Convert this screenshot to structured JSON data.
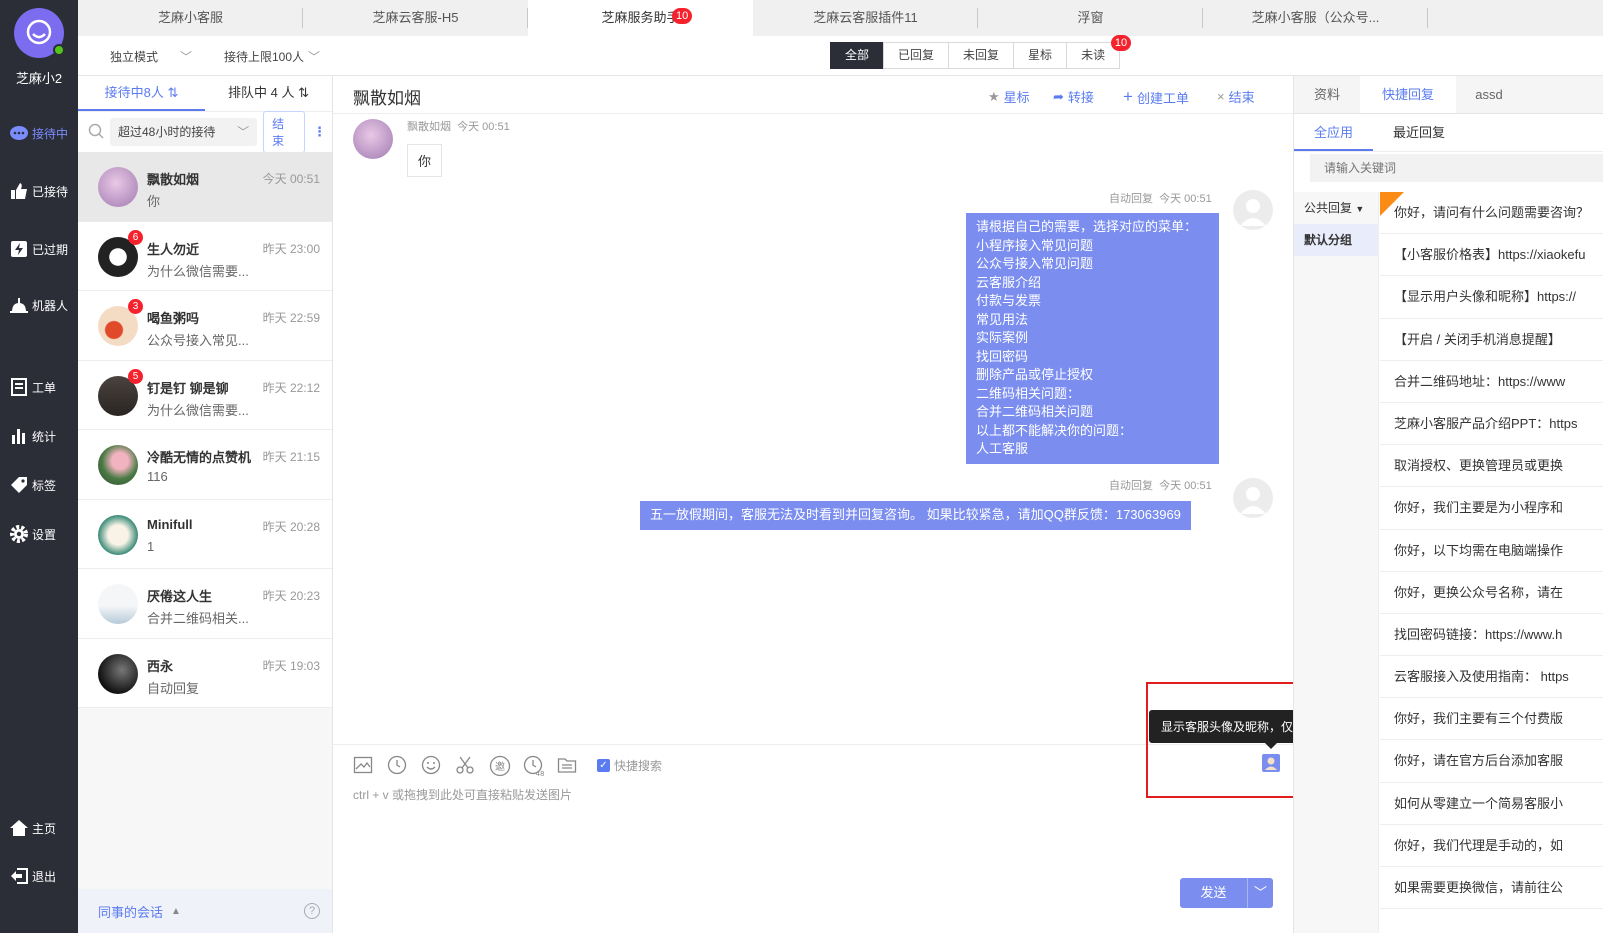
{
  "nav": {
    "username": "芝麻小2",
    "items": [
      {
        "label": "接待中",
        "icon": "chat-bubble-icon",
        "active": true
      },
      {
        "label": "已接待",
        "icon": "thumb-up-icon"
      },
      {
        "label": "已过期",
        "icon": "lightning-icon"
      },
      {
        "label": "机器人",
        "icon": "robot-icon"
      },
      {
        "label": "工单",
        "icon": "document-icon"
      },
      {
        "label": "统计",
        "icon": "bar-chart-icon"
      },
      {
        "label": "标签",
        "icon": "tag-icon"
      },
      {
        "label": "设置",
        "icon": "gear-icon"
      },
      {
        "label": "主页",
        "icon": "home-icon"
      },
      {
        "label": "退出",
        "icon": "logout-icon"
      }
    ]
  },
  "top_tabs": [
    {
      "label": "芝麻小客服"
    },
    {
      "label": "芝麻云客服-H5"
    },
    {
      "label": "芝麻服务助手",
      "badge": "10",
      "active": true
    },
    {
      "label": "芝麻云客服插件11"
    },
    {
      "label": "浮窗"
    },
    {
      "label": "芝麻小客服（公众号..."
    }
  ],
  "filter": {
    "mode": "独立模式",
    "limit": "接待上限100人",
    "segments": [
      "全部",
      "已回复",
      "未回复",
      "星标",
      "未读"
    ],
    "unread_badge": "10"
  },
  "sessions": {
    "tab_serving": "接待中8人",
    "tab_queue": "排队中 4 人",
    "filter": "超过48小时的接待",
    "end_label": "结束",
    "list": [
      {
        "name": "飘散如烟",
        "time": "今天 00:51",
        "preview": "你",
        "badge": ""
      },
      {
        "name": "生人勿近",
        "time": "昨天 23:00",
        "preview": "为什么微信需要...",
        "badge": "6"
      },
      {
        "name": "喝鱼粥吗",
        "time": "昨天 22:59",
        "preview": "公众号接入常见...",
        "badge": "3"
      },
      {
        "name": "钉是钉 铆是铆",
        "time": "昨天 22:12",
        "preview": "为什么微信需要...",
        "badge": "5"
      },
      {
        "name": "冷酷无情的点赞机",
        "time": "昨天 21:15",
        "preview": "116",
        "badge": ""
      },
      {
        "name": "Minifull",
        "time": "昨天 20:28",
        "preview": "1",
        "badge": ""
      },
      {
        "name": "厌倦这人生",
        "time": "昨天 20:23",
        "preview": "合并二维码相关...",
        "badge": ""
      },
      {
        "name": "西永",
        "time": "昨天 19:03",
        "preview": "自动回复",
        "badge": ""
      }
    ],
    "colleague": "同事的会话",
    "help": "?"
  },
  "chat": {
    "title": "飘散如烟",
    "actions": {
      "star": "星标",
      "transfer": "转接",
      "create_ticket": "创建工单",
      "end": "结束"
    },
    "msg1": {
      "sender": "飘散如烟",
      "time": "今天 00:51",
      "text": "你"
    },
    "msg2": {
      "sender": "自动回复",
      "time": "今天 00:51",
      "lines": [
        "请根据自己的需要，选择对应的菜单：",
        "小程序接入常见问题",
        "公众号接入常见问题",
        "云客服介绍",
        "付款与发票",
        "常见用法",
        "实际案例",
        "找回密码",
        "删除产品或停止授权",
        "二维码相关问题：",
        "合并二维码相关问题",
        "以上都不能解决你的问题：",
        "人工客服"
      ]
    },
    "msg3": {
      "sender": "自动回复",
      "time": "今天 00:51",
      "text": "五一放假期间，客服无法及时看到并回复咨询。 如果比较紧急，请加QQ群反馈：173063969"
    },
    "quick_search": "快捷搜索",
    "input_hint": "ctrl + v 或拖拽到此处可直接粘贴发送图片",
    "tooltip": "显示客服头像及昵称，仅对当前产品有效。",
    "send": "发送",
    "timer_label": "48"
  },
  "right": {
    "tabs": [
      "资料",
      "快捷回复",
      "assd"
    ],
    "subtabs": [
      "全应用",
      "最近回复"
    ],
    "search_placeholder": "请输入关键词",
    "groups": [
      "公共回复",
      "默认分组"
    ],
    "replies": [
      "你好，请问有什么问题需要咨询？",
      "【小客服价格表】https://xiaokefu",
      "【显示用户头像和昵称】https://",
      "【开启 / 关闭手机消息提醒】",
      "合并二维码地址：https://www",
      "芝麻小客服产品介绍PPT：https",
      "取消授权、更换管理员或更换",
      "你好，我们主要是为小程序和",
      "你好，以下均需在电脑端操作",
      "你好，更换公众号名称，请在",
      "找回密码链接：https://www.h",
      "云客服接入及使用指南： https",
      "你好，我们主要有三个付费版",
      "你好，请在官方后台添加客服",
      "如何从零建立一个简易客服小",
      "你好，我们代理是手动的，如",
      "如果需要更换微信，请前往公"
    ]
  },
  "colors": {
    "accent": "#5b7cf0",
    "bubble": "#7b8ef0",
    "nav_bg": "#2b2d37",
    "badge": "#f5222d",
    "highlight_box": "#e01e1e"
  }
}
